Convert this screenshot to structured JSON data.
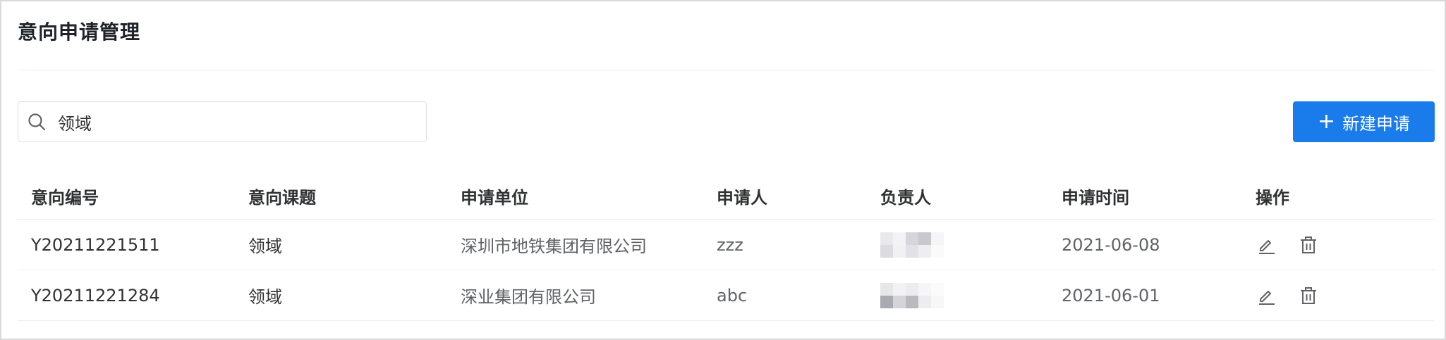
{
  "page": {
    "title": "意向申请管理"
  },
  "search": {
    "value": "领域",
    "icon": "search-icon"
  },
  "toolbar": {
    "new_label": "新建申请",
    "new_icon": "plus-icon",
    "accent": "#1a7bea"
  },
  "table": {
    "columns": [
      "意向编号",
      "意向课题",
      "申请单位",
      "申请人",
      "负责人",
      "申请时间",
      "操作"
    ],
    "rows": [
      {
        "id": "Y20211221511",
        "topic": "领域",
        "unit": "深圳市地铁集团有限公司",
        "applicant": "zzz",
        "owner": "",
        "time": "2021-06-08"
      },
      {
        "id": "Y20211221284",
        "topic": "领域",
        "unit": "深业集团有限公司",
        "applicant": "abc",
        "owner": "",
        "time": "2021-06-01"
      }
    ],
    "action_icons": [
      "edit-icon",
      "delete-icon"
    ]
  }
}
